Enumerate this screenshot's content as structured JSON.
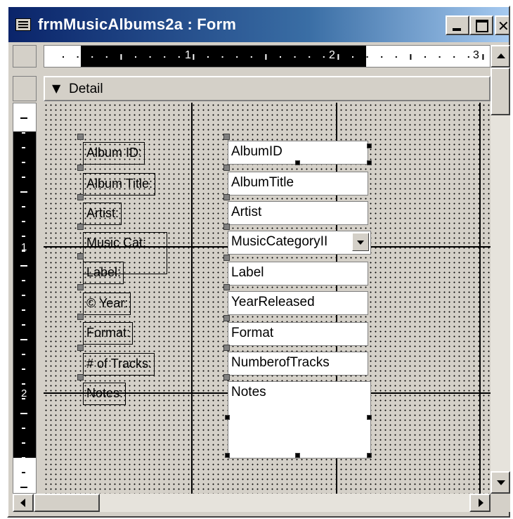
{
  "window": {
    "title": "frmMusicAlbums2a : Form"
  },
  "ruler": {
    "marks": [
      "1",
      "2",
      "3"
    ],
    "vertical_marks": [
      "1",
      "2"
    ]
  },
  "section": {
    "label": "Detail"
  },
  "labels": [
    "Album ID:",
    "Album Title:",
    "Artist:",
    "Music Cat:",
    "Label:",
    "© Year:",
    "Format:",
    "# of Tracks:",
    "Notes:"
  ],
  "fields": [
    "AlbumID",
    "AlbumTitle",
    "Artist",
    "MusicCategoryII",
    "Label",
    "YearReleased",
    "Format",
    "NumberofTracks",
    "Notes"
  ],
  "colors": {
    "title_start": "#0a246a",
    "title_end": "#a6caf0",
    "face": "#d4d0c8"
  }
}
